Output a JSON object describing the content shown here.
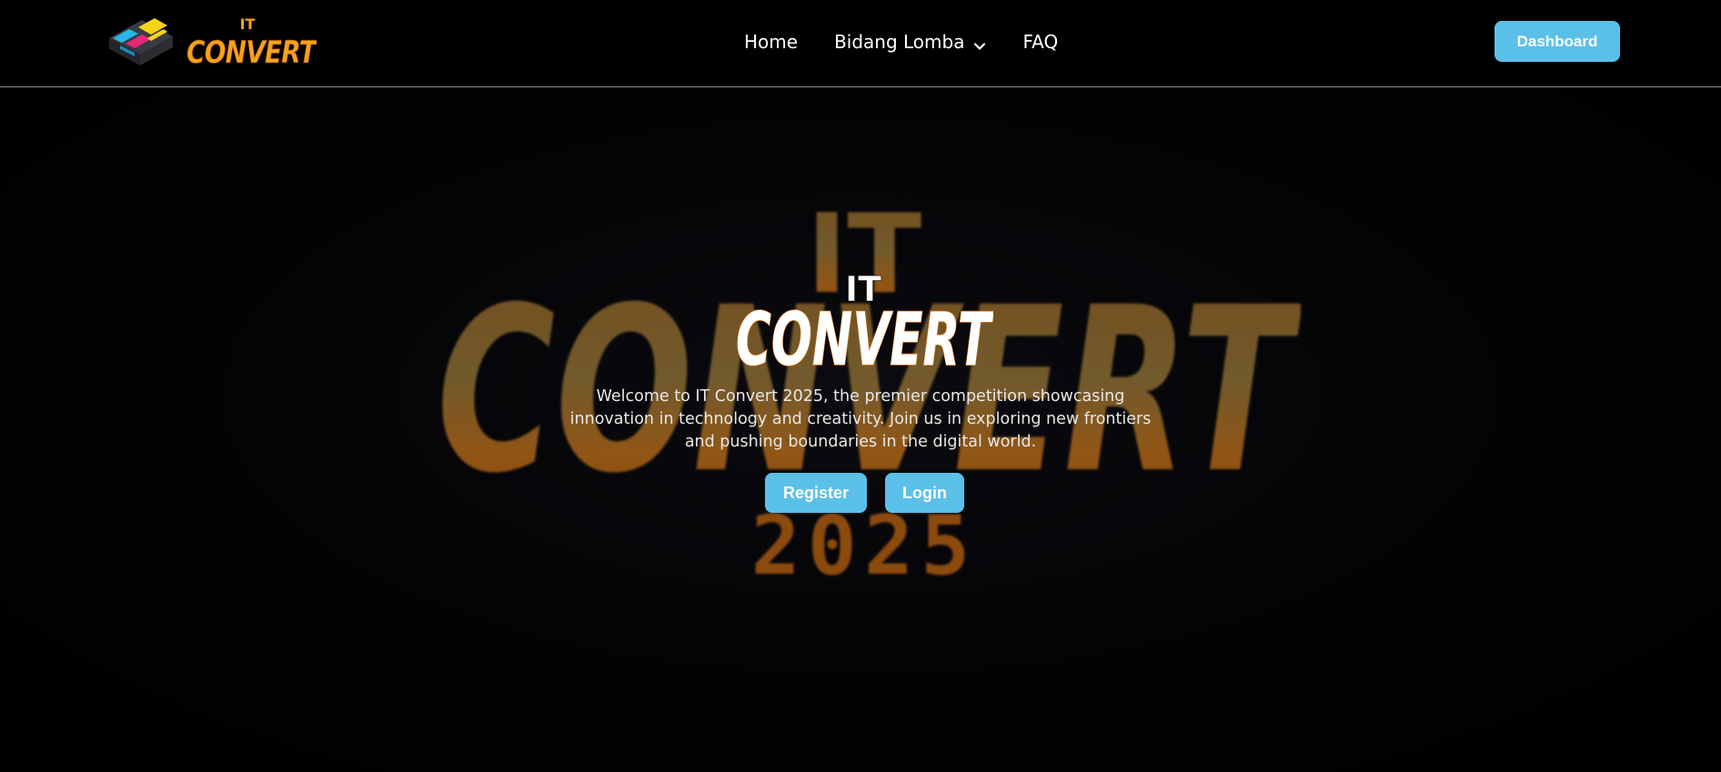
{
  "brand": {
    "logo_text_top": "IT",
    "logo_text_main": "CONVERT",
    "logo_icon": "it-convert-cube-logo-icon"
  },
  "nav": {
    "items": [
      {
        "label": "Home"
      },
      {
        "label": "Bidang Lomba",
        "has_dropdown": true,
        "icon": "chevron-down-icon"
      },
      {
        "label": "FAQ"
      }
    ],
    "dashboard_label": "Dashboard"
  },
  "hero": {
    "background_text_top": "IT",
    "background_text_main": "CONVERT",
    "background_text_year": "2025",
    "logo_text_top": "IT",
    "logo_text_main": "CONVERT",
    "description": "Welcome to IT Convert 2025, the premier competition showcasing innovation in technology and creativity. Join us in exploring new frontiers and pushing boundaries in the digital world.",
    "register_label": "Register",
    "login_label": "Login"
  },
  "colors": {
    "accent": "#5bc0e8",
    "background": "#000000",
    "brand_orange": "#f7a21b",
    "brand_pink": "#e5287b",
    "brand_cyan": "#29b6e8",
    "brand_yellow": "#f6d21b"
  }
}
